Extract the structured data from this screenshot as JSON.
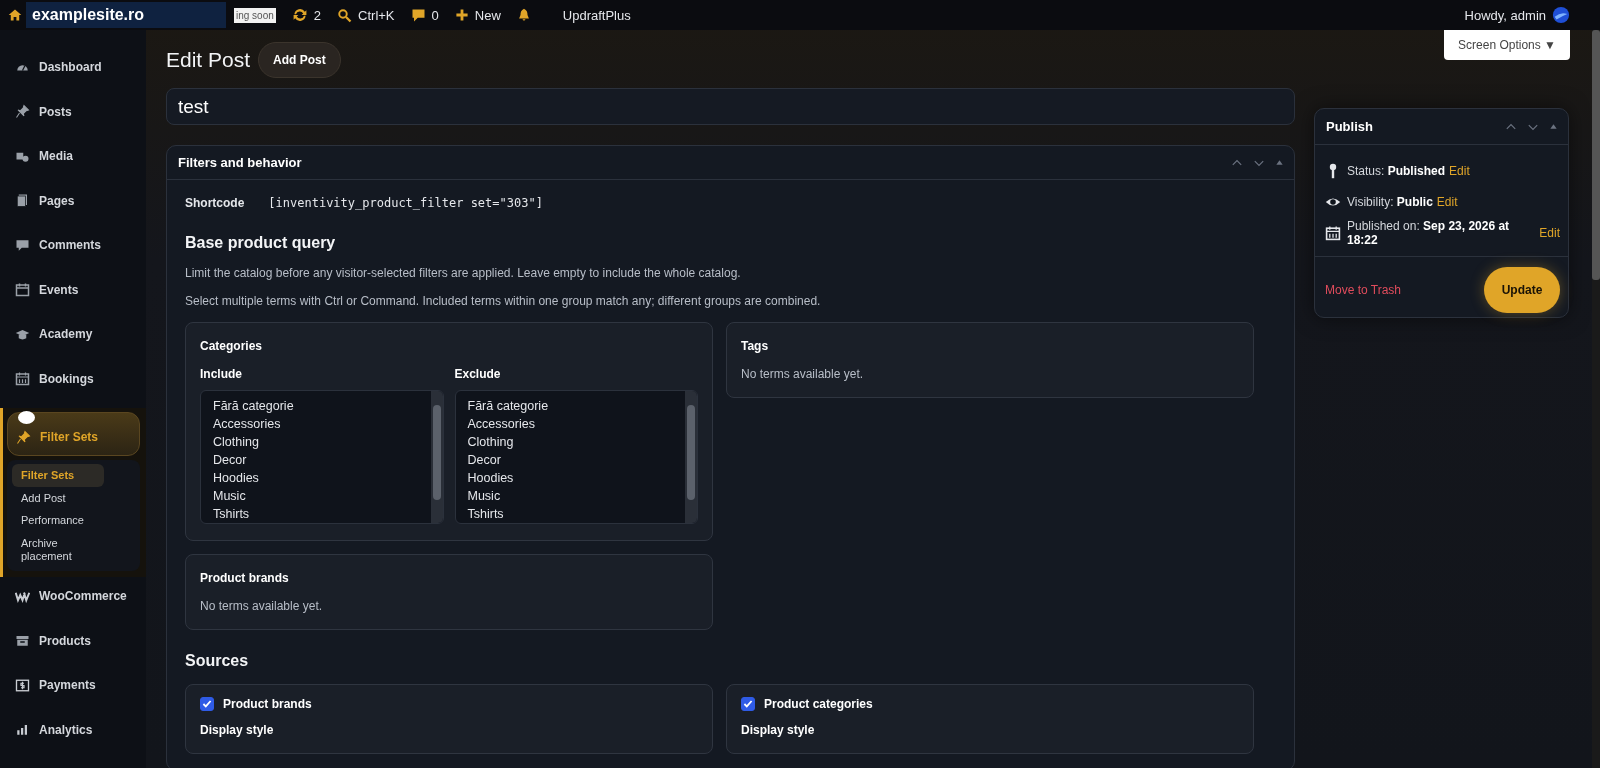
{
  "admin_bar": {
    "site_title": "examplesite.ro",
    "coming_soon": "ing soon",
    "updates_count": "2",
    "search_shortcut": "Ctrl+K",
    "comments_count": "0",
    "new_label": "New",
    "plugin_label": "UpdraftPlus",
    "greeting": "Howdy, admin"
  },
  "sidebar": {
    "items": [
      {
        "label": "Dashboard",
        "selected": false
      },
      {
        "label": "Posts",
        "selected": false
      },
      {
        "label": "Media",
        "selected": false
      },
      {
        "label": "Pages",
        "selected": false
      },
      {
        "label": "Comments",
        "selected": false
      },
      {
        "label": "Events",
        "selected": false
      },
      {
        "label": "Academy",
        "selected": false
      },
      {
        "label": "Bookings",
        "selected": false
      },
      {
        "label": "Filter Sets",
        "selected": true,
        "children": [
          {
            "label": "Filter Sets",
            "selected": true
          },
          {
            "label": "Add Post",
            "selected": false
          },
          {
            "label": "Performance",
            "selected": false
          },
          {
            "label": "Archive placement",
            "selected": false
          }
        ]
      },
      {
        "label": "WooCommerce",
        "selected": false
      },
      {
        "label": "Products",
        "selected": false
      },
      {
        "label": "Payments",
        "selected": false
      },
      {
        "label": "Analytics",
        "selected": false
      }
    ]
  },
  "page": {
    "heading": "Edit Post",
    "add_button": "Add Post",
    "screen_options": "Screen Options ▼",
    "title_value": "test"
  },
  "metabox": {
    "title": "Filters and behavior",
    "shortcode_label": "Shortcode",
    "shortcode": "[inventivity_product_filter set=\"303\"]",
    "base_query": {
      "heading": "Base product query",
      "notes": [
        "Limit the catalog before any visitor-selected filters are applied. Leave empty to include the whole catalog.",
        "Select multiple terms with Ctrl or Command. Included terms within one group match any; different groups are combined."
      ],
      "categories": {
        "title": "Categories",
        "lists": [
          {
            "label": "Include",
            "options": [
              "Fără categorie",
              "Accessories",
              "Clothing",
              "Decor",
              "Hoodies",
              "Music",
              "Tshirts"
            ]
          },
          {
            "label": "Exclude",
            "options": [
              "Fără categorie",
              "Accessories",
              "Clothing",
              "Decor",
              "Hoodies",
              "Music",
              "Tshirts"
            ]
          }
        ]
      },
      "tags": {
        "title": "Tags",
        "empty": "No terms available yet."
      },
      "brands": {
        "title": "Product brands",
        "empty": "No terms available yet."
      }
    },
    "sources": {
      "heading": "Sources",
      "items": [
        {
          "label": "Product brands",
          "checked": true,
          "field_label": "Display style"
        },
        {
          "label": "Product categories",
          "checked": true,
          "field_label": "Display style"
        }
      ]
    }
  },
  "publish": {
    "title": "Publish",
    "rows": [
      {
        "kind": "status",
        "label": "Status:",
        "value": "Published",
        "link": "Edit"
      },
      {
        "kind": "visibility",
        "label": "Visibility:",
        "value": "Public",
        "link": "Edit"
      },
      {
        "kind": "date",
        "label": "Published on:",
        "value": "Sep 23, 2026 at 18:22",
        "link": "Edit"
      }
    ],
    "trash": "Move to Trash",
    "update": "Update"
  }
}
